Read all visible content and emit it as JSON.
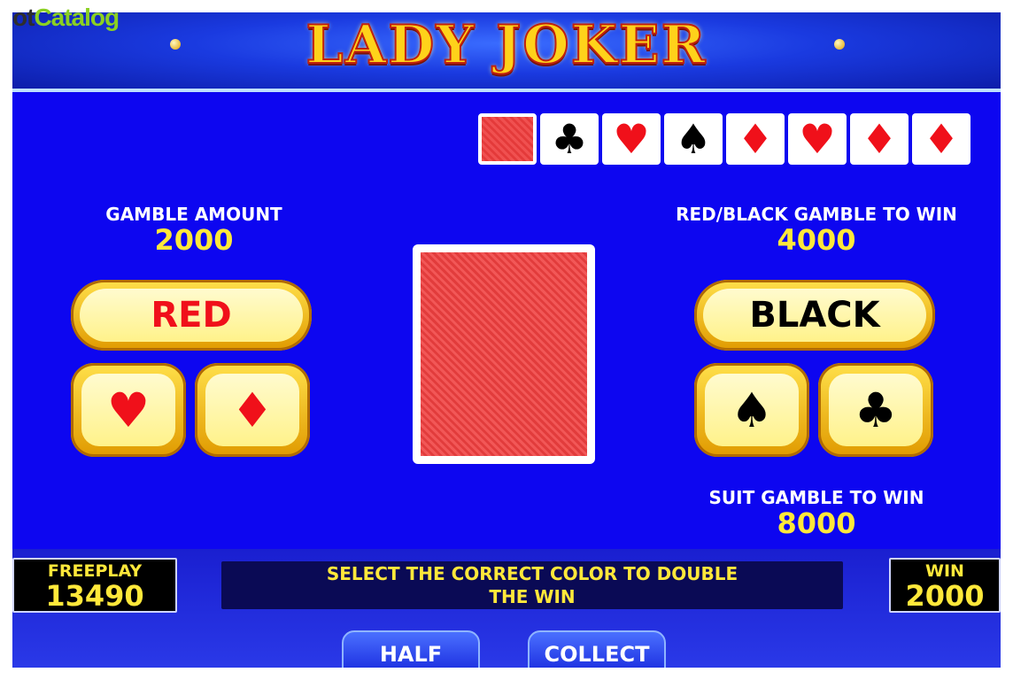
{
  "watermark": {
    "prefix": "ot",
    "brand": "Catalog"
  },
  "game": {
    "title": "LADY JOKER"
  },
  "history": [
    {
      "type": "back",
      "suit": ""
    },
    {
      "type": "card",
      "suit": "♣",
      "color": "black"
    },
    {
      "type": "card",
      "suit": "♥",
      "color": "red"
    },
    {
      "type": "card",
      "suit": "♠",
      "color": "black"
    },
    {
      "type": "card",
      "suit": "♦",
      "color": "red"
    },
    {
      "type": "card",
      "suit": "♥",
      "color": "red"
    },
    {
      "type": "card",
      "suit": "♦",
      "color": "red"
    },
    {
      "type": "card",
      "suit": "♦",
      "color": "red"
    }
  ],
  "gamble": {
    "amount_label": "GAMBLE AMOUNT",
    "amount_value": "2000",
    "color_win_label": "RED/BLACK GAMBLE TO WIN",
    "color_win_value": "4000",
    "suit_win_label": "SUIT GAMBLE TO WIN",
    "suit_win_value": "8000"
  },
  "buttons": {
    "red": "RED",
    "black": "BLACK",
    "heart": "♥",
    "diamond": "♦",
    "spade": "♠",
    "club": "♣",
    "half": "HALF",
    "collect": "COLLECT"
  },
  "meters": {
    "freeplay_label": "FREEPLAY",
    "freeplay_value": "13490",
    "win_label": "WIN",
    "win_value": "2000"
  },
  "message": {
    "line1": "SELECT THE CORRECT COLOR TO DOUBLE",
    "line2": "THE WIN"
  },
  "colors": {
    "accent_yellow": "#ffe83a",
    "table_blue": "#0d06f0",
    "suit_red": "#f0101a"
  }
}
